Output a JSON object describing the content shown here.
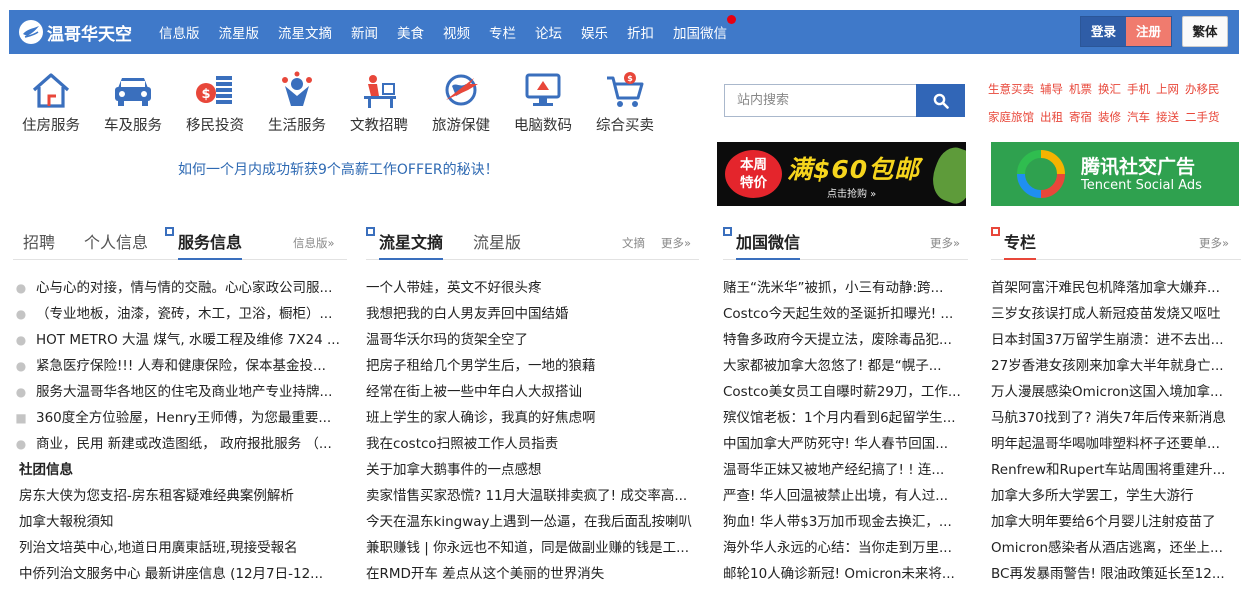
{
  "header": {
    "logo_text": "温哥华天空",
    "nav": [
      "信息版",
      "流星版",
      "流星文摘",
      "新闻",
      "美食",
      "视频",
      "专栏",
      "论坛",
      "娱乐",
      "折扣",
      "加国微信"
    ],
    "login_label": "登录",
    "register_label": "注册",
    "traditional_label": "繁体"
  },
  "categories": [
    {
      "label": "住房服务",
      "icon": "house-icon"
    },
    {
      "label": "车及服务",
      "icon": "car-icon"
    },
    {
      "label": "移民投资",
      "icon": "money-stack-icon"
    },
    {
      "label": "生活服务",
      "icon": "people-icon"
    },
    {
      "label": "文教招聘",
      "icon": "desk-icon"
    },
    {
      "label": "旅游保健",
      "icon": "globe-plane-icon"
    },
    {
      "label": "电脑数码",
      "icon": "computer-icon"
    },
    {
      "label": "综合买卖",
      "icon": "cart-icon"
    }
  ],
  "promo_text": "如何一个月内成功斩获9个高薪工作OFFER的秘诀！",
  "search": {
    "placeholder": "站内搜索"
  },
  "quick_links": [
    [
      "生意买卖",
      "辅导",
      "机票",
      "换汇",
      "手机",
      "上网",
      "办移民"
    ],
    [
      "家庭旅馆",
      "出租",
      "寄宿",
      "装修",
      "汽车",
      "接送",
      "二手货"
    ]
  ],
  "ads": {
    "ad1": {
      "badge_line1": "本周",
      "badge_line2": "特价",
      "main": "满$60包邮",
      "sub": "点击抢购 »"
    },
    "ad2": {
      "main": "腾讯社交广告",
      "sub": "Tencent Social Ads"
    }
  },
  "columns": [
    {
      "tabs": [
        "招聘",
        "个人信息",
        "服务信息"
      ],
      "more": [
        "信息版»"
      ],
      "items": [
        {
          "icon": "chat-icon",
          "text": "心与心的对接，情与情的交融。心心家政公司服..."
        },
        {
          "icon": "pin-icon",
          "text": "（专业地板，油漆，瓷砖，木工，卫浴，橱柜）..."
        },
        {
          "icon": "pin-icon",
          "text": "HOT METRO 大温 煤气, 水暖工程及维修 7X24 ..."
        },
        {
          "icon": "pin-icon",
          "text": "紧急医疗保险!!! 人寿和健康保险，保本基金投..."
        },
        {
          "icon": "pin-icon",
          "text": "服务大温哥华各地区的住宅及商业地产专业持牌..."
        },
        {
          "icon": "mail-icon",
          "text": "360度全方位验屋，Henry王师傅，为您最重要..."
        },
        {
          "icon": "pin-icon",
          "text": "商业，民用 新建或改造图纸， 政府报批服务 （..."
        }
      ],
      "section_title": "社团信息",
      "section_items": [
        "房东大侠为您支招-房东租客疑难经典案例解析",
        "加拿大報稅須知",
        "列治文培英中心,地道日用廣東話班,現接受報名",
        "中侨列治文服务中心 最新讲座信息 (12月7日-12..."
      ]
    },
    {
      "tabs": [
        "流星文摘",
        "流星版"
      ],
      "more": [
        "文摘",
        "更多»"
      ],
      "items": [
        "一个人带娃，英文不好很头疼",
        "我想把我的白人男友弄回中国结婚",
        "温哥华沃尔玛的货架全空了",
        "把房子租给几个男学生后，一地的狼藉",
        "经常在街上被一些中年白人大叔搭讪",
        "班上学生的家人确诊，我真的好焦虑啊",
        "我在costco扫照被工作人员指责",
        "关于加拿大鹅事件的一点感想",
        "卖家惜售买家恐慌? 11月大温联排卖疯了! 成交率高...",
        "今天在温东kingway上遇到一怂逼，在我后面乱按喇叭",
        "兼职赚钱 | 你永远也不知道，同是做副业赚的钱是工...",
        "在RMD开车 差点从这个美丽的世界消失"
      ]
    },
    {
      "tabs": [
        "加国微信"
      ],
      "more": [
        "更多»"
      ],
      "items": [
        "赌王“洗米华”被抓，小三有动静:跨...",
        "Costco今天起生效的圣诞折扣曝光! ...",
        "特鲁多政府今天提立法，废除毒品犯...",
        "大家都被加拿大忽悠了! 都是“幌子...",
        "Costco美女员工自曝时薪29刀，工作...",
        "殡仪馆老板：1个月内看到6起留学生...",
        "中国加拿大严防死守! 华人春节回国...",
        "温哥华正妹又被地产经纪搞了! ! 连...",
        "严查! 华人回温被禁止出境，有人过...",
        "狗血! 华人带$3万加币现金去换汇，...",
        "海外华人永远的心结：当你走到万里...",
        "邮轮10人确诊新冠! Omicron未来将..."
      ]
    },
    {
      "tabs": [
        "专栏"
      ],
      "more": [
        "更多»"
      ],
      "items": [
        "首架阿富汗难民包机降落加拿大嫌弃...",
        "三岁女孩误打成人新冠疫苗发烧又呕吐",
        "日本封国37万留学生崩溃：进不去出...",
        "27岁香港女孩刚来加拿大半年就身亡...",
        "万人漫展感染Omicron这国入境加拿...",
        "马航370找到了? 消失7年后传来新消息",
        "明年起温哥华喝咖啡塑料杯子还要单...",
        "Renfrew和Rupert车站周围将重建升...",
        "加拿大多所大学罢工，学生大游行",
        "加拿大明年要给6个月婴儿注射疫苗了",
        "Omicron感染者从酒店逃离，还坐上...",
        "BC再发暴雨警告! 限油政策延长至12..."
      ]
    }
  ],
  "colors": {
    "nav_bg": "#3f79c9",
    "accent_blue": "#3a6fbd",
    "accent_red": "#e8473a",
    "promo_blue": "#2f6ab3"
  }
}
